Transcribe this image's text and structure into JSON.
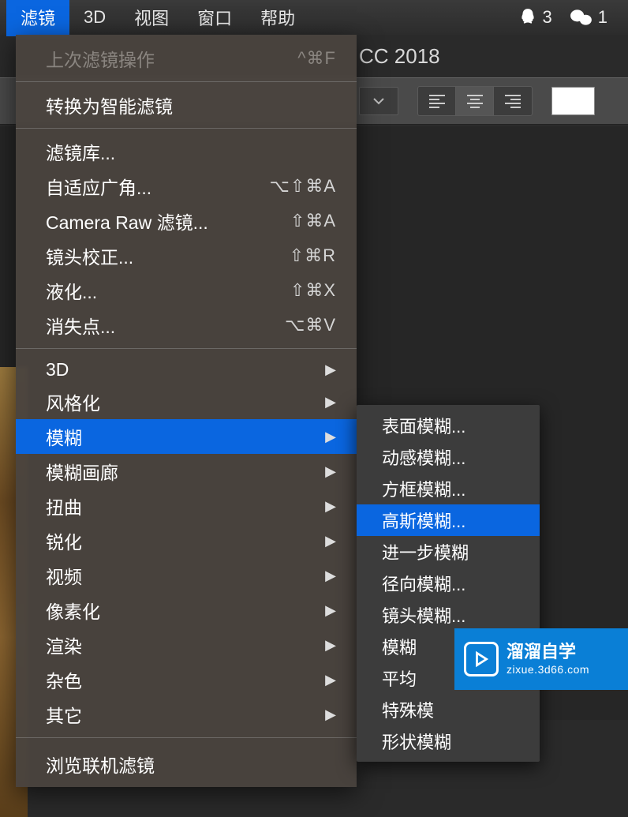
{
  "menubar": {
    "items": [
      "滤镜",
      "3D",
      "视图",
      "窗口",
      "帮助"
    ],
    "status": {
      "qq_count": "3",
      "wechat_count": "1"
    }
  },
  "app": {
    "title_fragment": "CC 2018"
  },
  "filter_menu": {
    "last_filter": {
      "label": "上次滤镜操作",
      "shortcut": "^⌘F"
    },
    "convert_smart": {
      "label": "转换为智能滤镜"
    },
    "filter_gallery": {
      "label": "滤镜库..."
    },
    "adaptive_wide": {
      "label": "自适应广角...",
      "shortcut": "⌥⇧⌘A"
    },
    "camera_raw": {
      "label": "Camera Raw 滤镜...",
      "shortcut": "⇧⌘A"
    },
    "lens_correction": {
      "label": "镜头校正...",
      "shortcut": "⇧⌘R"
    },
    "liquify": {
      "label": "液化...",
      "shortcut": "⇧⌘X"
    },
    "vanishing": {
      "label": "消失点...",
      "shortcut": "⌥⌘V"
    },
    "sub_3d": {
      "label": "3D"
    },
    "stylize": {
      "label": "风格化"
    },
    "blur": {
      "label": "模糊"
    },
    "blur_gallery": {
      "label": "模糊画廊"
    },
    "distort": {
      "label": "扭曲"
    },
    "sharpen": {
      "label": "锐化"
    },
    "video": {
      "label": "视频"
    },
    "pixelate": {
      "label": "像素化"
    },
    "render": {
      "label": "渲染"
    },
    "noise": {
      "label": "杂色"
    },
    "other": {
      "label": "其它"
    },
    "browse_online": {
      "label": "浏览联机滤镜"
    }
  },
  "blur_submenu": {
    "surface": "表面模糊...",
    "motion": "动感模糊...",
    "box": "方框模糊...",
    "gaussian": "高斯模糊...",
    "further": "进一步模糊",
    "radial": "径向模糊...",
    "lens": "镜头模糊...",
    "blur": "模糊",
    "average": "平均",
    "special": "特殊模",
    "shape": "形状模糊"
  },
  "watermark": {
    "title": "溜溜自学",
    "url": "zixue.3d66.com"
  }
}
